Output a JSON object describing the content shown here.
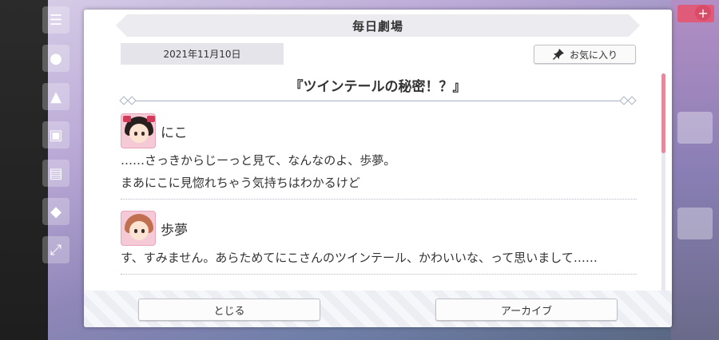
{
  "dialog": {
    "title": "毎日劇場",
    "date": "2021年11月10日",
    "favorite_label": "お気に入り",
    "story_title": "『ツインテールの秘密！？』",
    "close_label": "とじる",
    "archive_label": "アーカイブ",
    "scroll_progress": 0.36
  },
  "entries": [
    {
      "speaker": "にこ",
      "avatar_hair": "#2a1f1f",
      "lines": [
        "……さっきからじーっと見て、なんなのよ、歩夢。",
        "まあにこに見惚れちゃう気持ちはわかるけど"
      ]
    },
    {
      "speaker": "歩夢",
      "avatar_hair": "#c0704e",
      "lines": [
        "す、すみません。あらためてにこさんのツインテール、かわいいな、って思いまして……"
      ]
    }
  ],
  "colors": {
    "accent": "#e58a9c",
    "divider": "#a9b2c4"
  },
  "icons": [
    "menu-icon",
    "chat-icon",
    "gift-icon",
    "message-icon",
    "trophy-icon",
    "expand-icon",
    "pin-icon"
  ]
}
